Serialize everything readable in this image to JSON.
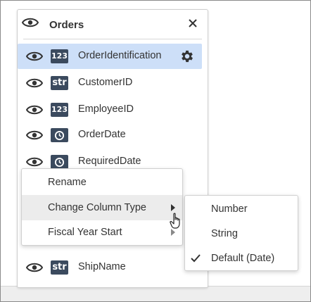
{
  "panel": {
    "title": "Orders",
    "header_icon": "eye-icon",
    "close_icon": "close-icon"
  },
  "columns": [
    {
      "name": "OrderIdentification",
      "type": "123",
      "visible": true,
      "selected": true
    },
    {
      "name": "CustomerID",
      "type": "str",
      "visible": true,
      "selected": false
    },
    {
      "name": "EmployeeID",
      "type": "123",
      "visible": true,
      "selected": false
    },
    {
      "name": "OrderDate",
      "type": "date",
      "visible": true,
      "selected": false
    },
    {
      "name": "RequiredDate",
      "type": "date",
      "visible": true,
      "selected": false
    },
    {
      "name": "ShipName",
      "type": "str",
      "visible": true,
      "selected": false
    }
  ],
  "context_menu": {
    "items": [
      {
        "label": "Rename",
        "has_submenu": false,
        "highlighted": false
      },
      {
        "label": "Change Column Type",
        "has_submenu": true,
        "highlighted": true
      },
      {
        "label": "Fiscal Year Start",
        "has_submenu": true,
        "highlighted": false
      }
    ]
  },
  "submenu": {
    "items": [
      {
        "label": "Number",
        "checked": false
      },
      {
        "label": "String",
        "checked": false
      },
      {
        "label": "Default (Date)",
        "checked": true
      }
    ]
  },
  "colors": {
    "selected_row": "#cddff8",
    "badge": "#3b4a5e",
    "menu_hover": "#ececec"
  }
}
